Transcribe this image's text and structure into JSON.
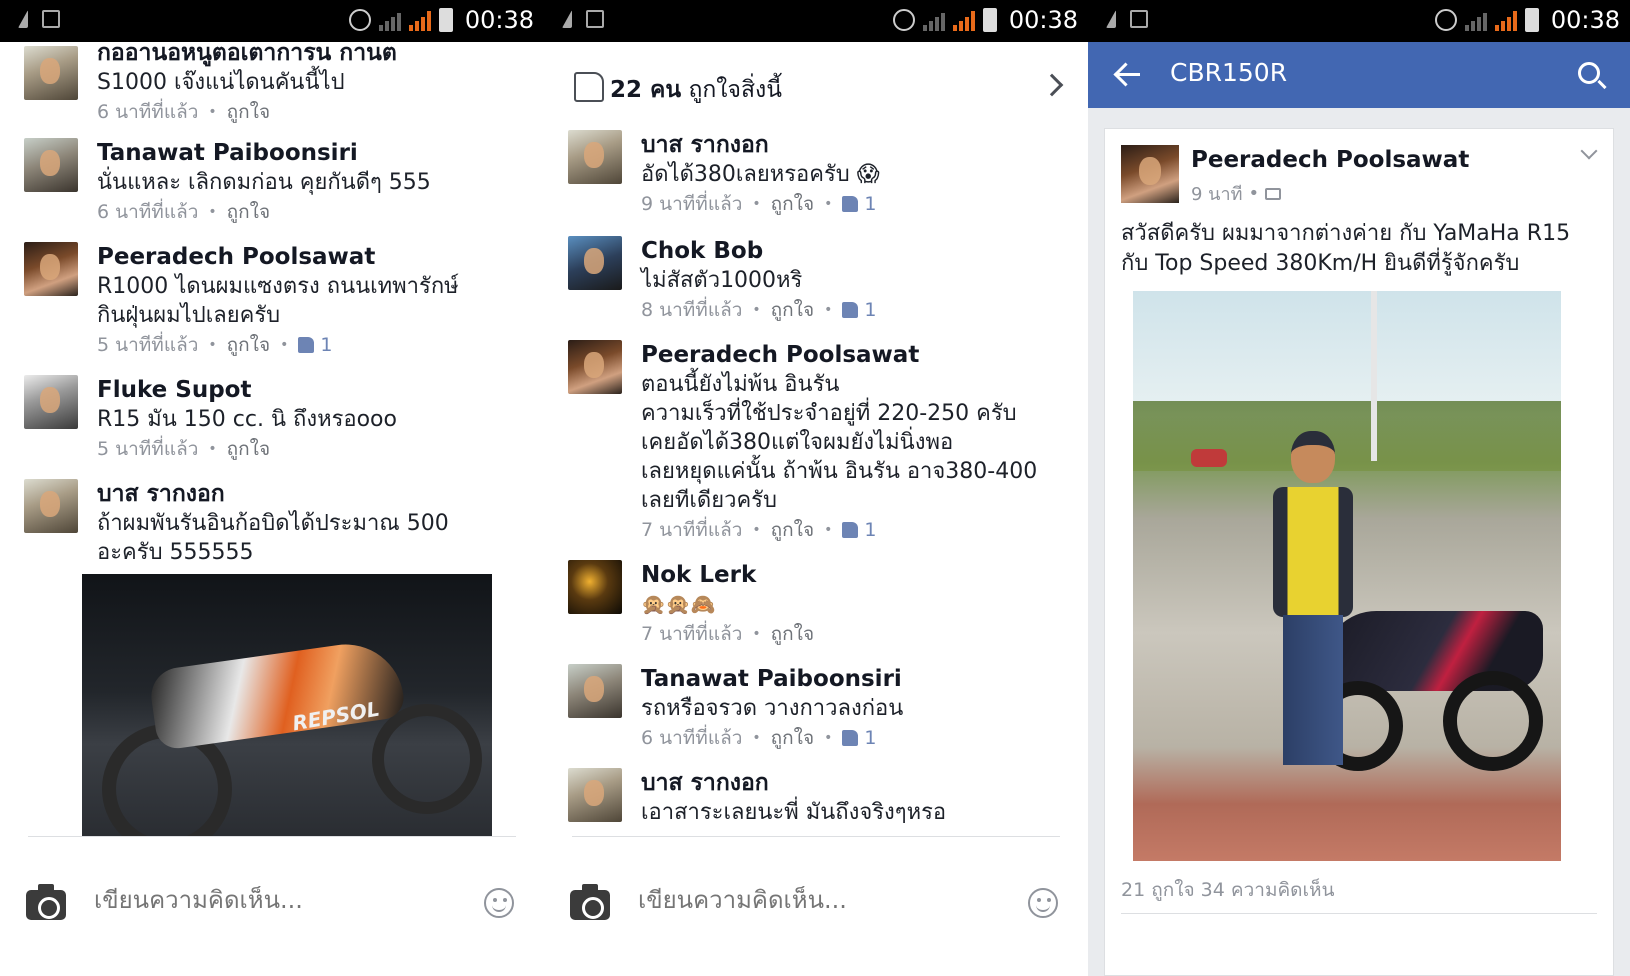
{
  "status_bar": {
    "time": "00:38"
  },
  "panel1": {
    "comments": [
      {
        "name": "กออานอหนูตอเตาการน กานต",
        "lines": [
          "S1000 เจ๊งแน่ไดนคันนี้ไป"
        ],
        "time": "6 นาทีที่แล้ว",
        "like_label": "ถูกใจ",
        "likes": ""
      },
      {
        "name": "Tanawat Paiboonsiri",
        "lines": [
          "นั่นแหละ เลิกดมก่อน คุยกันดีๆ 555"
        ],
        "time": "6 นาทีที่แล้ว",
        "like_label": "ถูกใจ",
        "likes": ""
      },
      {
        "name": "Peeradech Poolsawat",
        "lines": [
          "R1000 ไดนผมแซงตรง ถนนเทพารักษ์",
          "กินฝุ่นผมไปเลยครับ"
        ],
        "time": "5 นาทีที่แล้ว",
        "like_label": "ถูกใจ",
        "likes": "1"
      },
      {
        "name": "Fluke Supot",
        "lines": [
          "R15 มัน 150 cc. นิ ถึงหรอooo"
        ],
        "time": "5 นาทีที่แล้ว",
        "like_label": "ถูกใจ",
        "likes": ""
      },
      {
        "name": "บาส รากงอก",
        "lines": [
          "ถ้าผมพันรันอินก้อบิดได้ประมาณ 500",
          "อะครับ 555555"
        ],
        "time": "",
        "like_label": "",
        "likes": ""
      }
    ],
    "photo_text": "REPSOL",
    "composer_placeholder": "เขียนความคิดเห็น..."
  },
  "panel2": {
    "likes_count": "22 คน",
    "likes_text": "ถูกใจสิ่งนี้",
    "comments": [
      {
        "name": "บาส รากงอก",
        "lines": [
          "อัดได้380เลยหรอครับ 😱"
        ],
        "time": "9 นาทีที่แล้ว",
        "like_label": "ถูกใจ",
        "likes": "1"
      },
      {
        "name": "Chok Bob",
        "lines": [
          "ไม่สัสตัว1000หริ"
        ],
        "time": "8 นาทีที่แล้ว",
        "like_label": "ถูกใจ",
        "likes": "1"
      },
      {
        "name": "Peeradech Poolsawat",
        "lines": [
          "ตอนนี้ยังไม่พ้น อินรัน",
          "ความเร็วที่ใช้ประจำอยู่ที่ 220-250 ครับ",
          "เคยอัดได้380แต่ใจผมยังไม่นิ่งพอ",
          "เลยหยุดแค่นั้น ถ้าพ้น อินรัน อาจ380-400",
          "เลยทีเดียวครับ"
        ],
        "time": "7 นาทีที่แล้ว",
        "like_label": "ถูกใจ",
        "likes": "1"
      },
      {
        "name": "Nok Lerk",
        "lines": [
          "🙊🙊🙈"
        ],
        "time": "7 นาทีที่แล้ว",
        "like_label": "ถูกใจ",
        "likes": ""
      },
      {
        "name": "Tanawat Paiboonsiri",
        "lines": [
          "รถหรือจรวด วางกาวลงก่อน"
        ],
        "time": "6 นาทีที่แล้ว",
        "like_label": "ถูกใจ",
        "likes": "1"
      },
      {
        "name": "บาส รากงอก",
        "lines": [
          "เอาสาระเลยนะพี่ มันถึงจริงๆหรอ"
        ],
        "time": "",
        "like_label": "",
        "likes": ""
      }
    ],
    "composer_placeholder": "เขียนความคิดเห็น..."
  },
  "panel3": {
    "title": "CBR150R",
    "post": {
      "author": "Peeradech Poolsawat",
      "time": "9 นาที",
      "lines": [
        "สวัสดีครับ ผมมาจากต่างค่าย กับ YaMaHa R15",
        "กับ Top Speed 380Km/H ยินดีที่รู้จักครับ"
      ],
      "stats": "21 ถูกใจ  34 ความคิดเห็น"
    }
  },
  "colors": {
    "facebook_blue": "#4267b2",
    "meta_gray": "#90949c",
    "text": "#1d2129"
  }
}
